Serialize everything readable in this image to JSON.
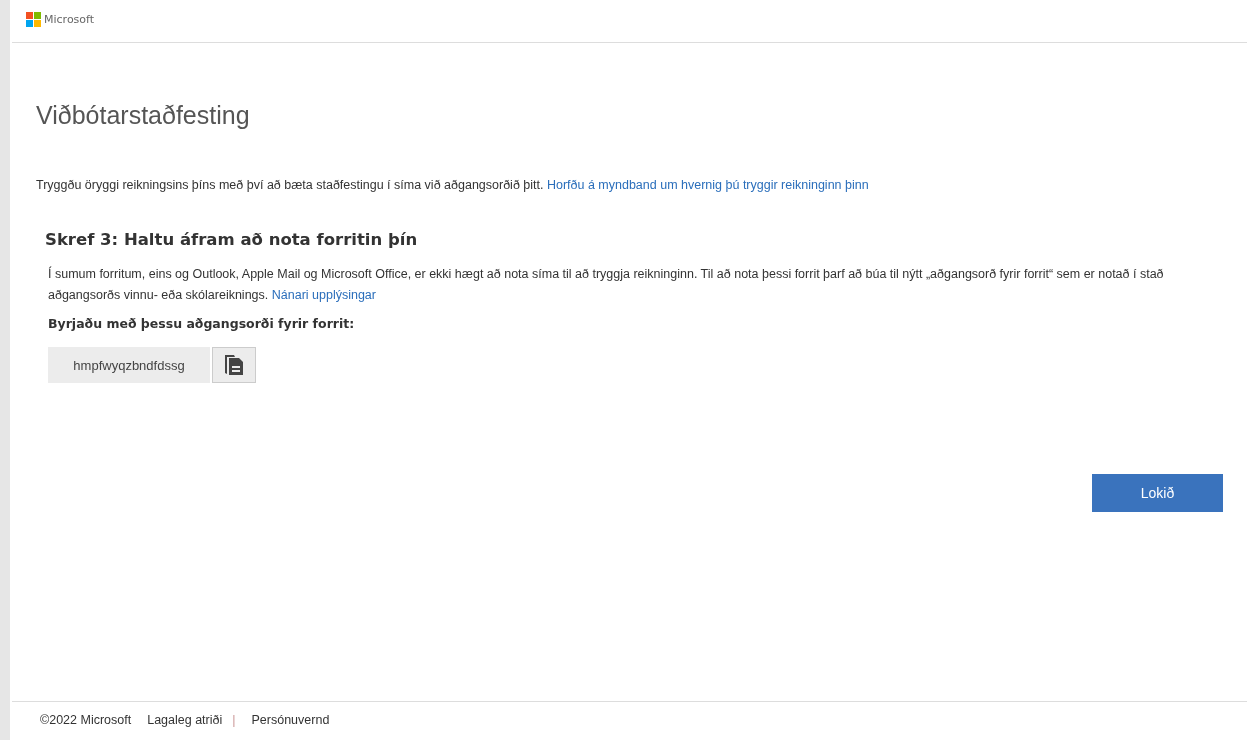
{
  "header": {
    "brand": "Microsoft"
  },
  "title": "Viðbótarstaðfesting",
  "intro": {
    "text": "Tryggðu öryggi reikningsins þíns með því að bæta staðfestingu í síma við aðgangsorðið þitt.",
    "link": "Horfðu á myndband um hvernig þú tryggir reikninginn þinn"
  },
  "step": {
    "heading": "Skref 3: Haltu áfram að nota forritin þín",
    "text": "Í sumum forritum, eins og Outlook, Apple Mail og Microsoft Office, er ekki hægt að nota síma til að tryggja reikninginn. Til að nota þessi forrit þarf að búa til nýtt „aðgangsorð fyrir forrit“ sem er notað í stað aðgangsorðs vinnu- eða skólareiknings.",
    "link": "Nánari upplýsingar",
    "label": "Byrjaðu með þessu aðgangsorði fyrir forrit:",
    "password": "hmpfwyqzbndfdssg"
  },
  "done_button": "Lokið",
  "footer": {
    "copyright": "©2022 Microsoft",
    "links": [
      "Lagaleg atriði",
      "Persónuvernd"
    ],
    "separator": "|"
  }
}
